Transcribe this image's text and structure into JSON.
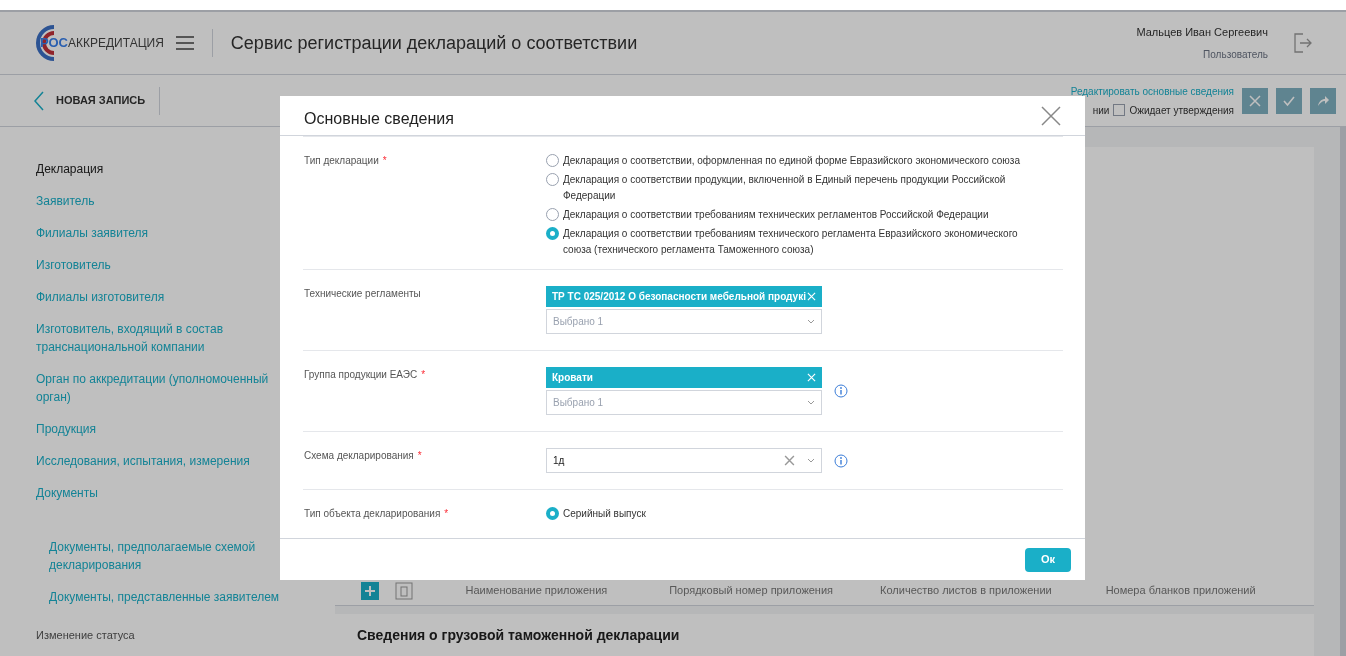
{
  "header": {
    "logo": {
      "part_1": "РОС",
      "part_2": "АККРЕДИТАЦИЯ"
    },
    "title": "Сервис регистрации деклараций о соответствии",
    "user": {
      "name": "Мальцев Иван Сергеевич",
      "role": "Пользователь"
    }
  },
  "toolbar": {
    "back_label": "НОВАЯ ЗАПИСЬ",
    "edit_link": "Редактировать основные сведения",
    "status_fragment": "нии",
    "awaiting": {
      "label": "Ожидает утверждения",
      "checked": false
    }
  },
  "sidebar": {
    "items": [
      {
        "label": "Декларация",
        "selected": true
      },
      {
        "label": "Заявитель",
        "selected": false
      },
      {
        "label": "Филиалы заявителя",
        "selected": false
      },
      {
        "label": "Изготовитель",
        "selected": false
      },
      {
        "label": "Филиалы изготовителя",
        "selected": false
      },
      {
        "label": "Изготовитель, входящий в состав транснациональной компании",
        "selected": false
      },
      {
        "label": "Орган по аккредитации (уполномоченный орган)",
        "selected": false
      },
      {
        "label": "Продукция",
        "selected": false
      },
      {
        "label": "Исследования, испытания, измерения",
        "selected": false
      },
      {
        "label": "Документы",
        "selected": false,
        "children": [
          {
            "label": "Документы, предполагаемые схемой декларирования",
            "selected": false
          },
          {
            "label": "Документы, представленные заявителем",
            "selected": false
          }
        ]
      }
    ],
    "section_label": "Изменение статуса"
  },
  "main": {
    "table": {
      "columns": [
        "Наименование приложения",
        "Порядковый номер приложения",
        "Количество листов в приложении",
        "Номера бланков приложений"
      ]
    },
    "section_title": "Сведения о грузовой таможенной декларации"
  },
  "modal": {
    "title": "Основные сведения",
    "fields": [
      {
        "kind": "radio_group",
        "label": "Тип декларации",
        "required_mark": "*",
        "options": [
          {
            "label": "Декларация о соответствии, оформленная по единой форме Евразийского экономического союза",
            "selected": false
          },
          {
            "label": "Декларация о соответствии продукции, включенной в Единый перечень продукции Российской Федерации",
            "selected": false
          },
          {
            "label": "Декларация о соответствии требованиям технических регламентов Российской Федерации",
            "selected": false
          },
          {
            "label": "Декларация о соответствии требованиям технического регламента Евразийского экономического союза (технического регламента Таможенного союза)",
            "selected": true
          }
        ]
      },
      {
        "kind": "tags",
        "label": "Технические регламенты",
        "tags": [
          "ТР ТС 025/2012 О безопасности мебельной продукі"
        ],
        "placeholder": "Выбрано 1"
      },
      {
        "kind": "tags",
        "label": "Группа продукции ЕАЭС",
        "required_mark": "*",
        "info": true,
        "tags": [
          "Кровати"
        ],
        "placeholder": "Выбрано 1"
      },
      {
        "kind": "select",
        "label": "Схема декларирования",
        "required_mark": "*",
        "info": true,
        "value": "1д"
      },
      {
        "kind": "radio_group",
        "label": "Тип объекта декларирования",
        "required_mark": "*",
        "options": [
          {
            "label": "Серийный выпуск",
            "selected": true
          }
        ]
      }
    ],
    "ok_button": "Ок"
  }
}
